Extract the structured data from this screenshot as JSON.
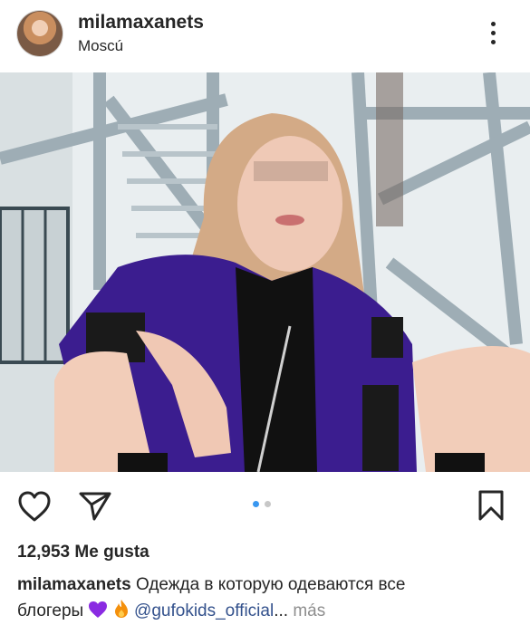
{
  "post": {
    "username": "milamaxanets",
    "location": "Moscú",
    "likes": "12,953 Me gusta",
    "caption": {
      "username": "milamaxanets",
      "text_line1": "Одежда в которую одеваются все",
      "text_line2": "блогеры",
      "heart": "purple-heart-emoji",
      "fire": "fire-emoji",
      "mention": "@gufokids_official",
      "ellipsis": "...",
      "more": "más"
    },
    "carousel": {
      "total": 2,
      "active": 1
    }
  },
  "colors": {
    "text": "#262626",
    "link": "#33518c",
    "muted": "#8e8e8e",
    "active_dot": "#3897f0",
    "inactive_dot": "#c7c7c7"
  },
  "icons": [
    "more-options-icon",
    "heart-icon",
    "share-icon",
    "bookmark-icon"
  ]
}
